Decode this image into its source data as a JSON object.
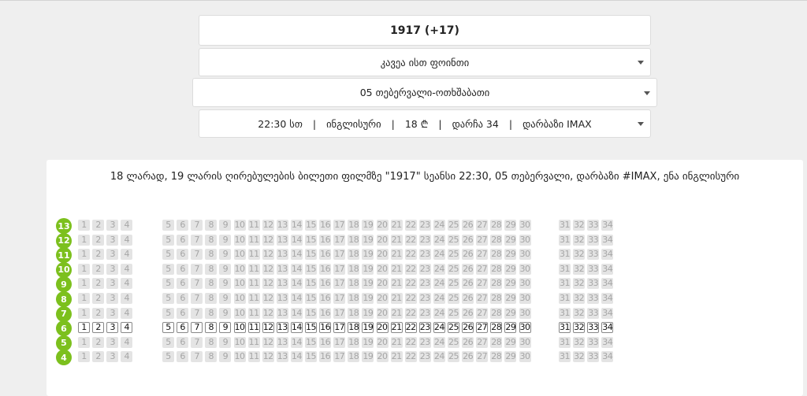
{
  "movie": {
    "title": "1917 (+17)"
  },
  "cinema": {
    "selected": "კავეა ისთ ფოინთი"
  },
  "date": {
    "selected": "05 თებერვალი-ოთხშაბათი"
  },
  "session": {
    "time": "22:30 სთ",
    "language": "ინგლისური",
    "price": "18 ₾",
    "seats_left": "დარჩა 34",
    "hall": "დარბაზი IMAX",
    "separator": "|"
  },
  "description": "18 ლარად, 19 ლარის ღირებულების ბილეთი ფილმზე \"1917\" სეანსი 22:30, 05 თებერვალი, დარბაზი #IMAX, ენა ინგლისური",
  "seatmap": {
    "accent_color": "#7cc01d",
    "available_row": "6",
    "rows": [
      "13",
      "12",
      "11",
      "10",
      "9",
      "8",
      "7",
      "6",
      "5",
      "4"
    ],
    "seats": [
      "1",
      "2",
      "3",
      "4",
      "5",
      "6",
      "7",
      "8",
      "9",
      "10",
      "11",
      "12",
      "13",
      "14",
      "15",
      "16",
      "17",
      "18",
      "19",
      "20",
      "21",
      "22",
      "23",
      "24",
      "25",
      "26",
      "27",
      "28",
      "29",
      "30",
      "31",
      "32",
      "33",
      "34"
    ]
  }
}
